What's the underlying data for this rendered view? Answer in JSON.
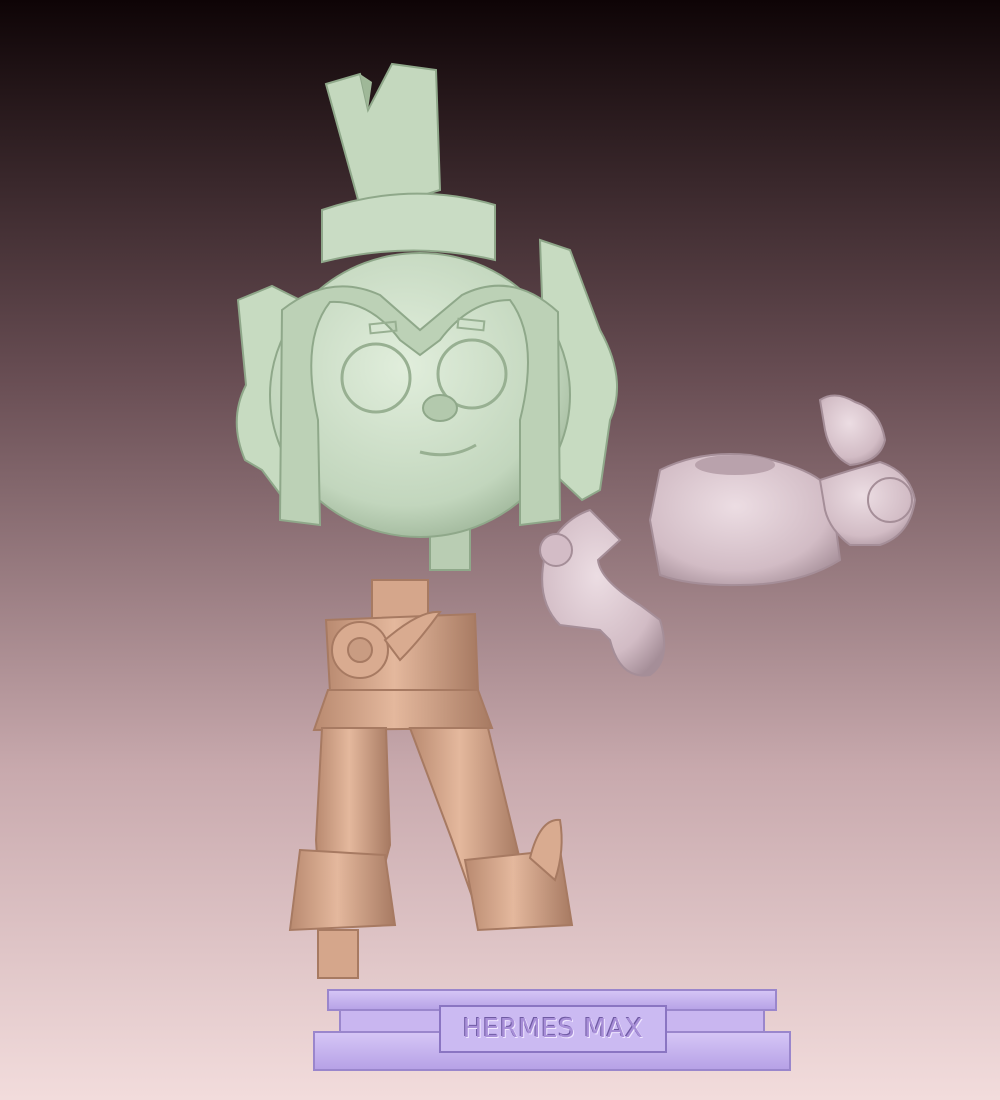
{
  "scene": {
    "description_kind": "3d-render",
    "colors": {
      "bg_top": "#0e0406",
      "bg_bottom": "#f2dcdc",
      "head": "#c9dcc4",
      "head_shade": "#8fa88a",
      "torso": "#d8c4cc",
      "torso_shade": "#a58e98",
      "legs": "#d9ab90",
      "legs_shade": "#a77a62",
      "base": "#c6b2ee",
      "base_shade": "#9a86cc"
    }
  },
  "plaque": {
    "label": "HERMES MAX"
  }
}
